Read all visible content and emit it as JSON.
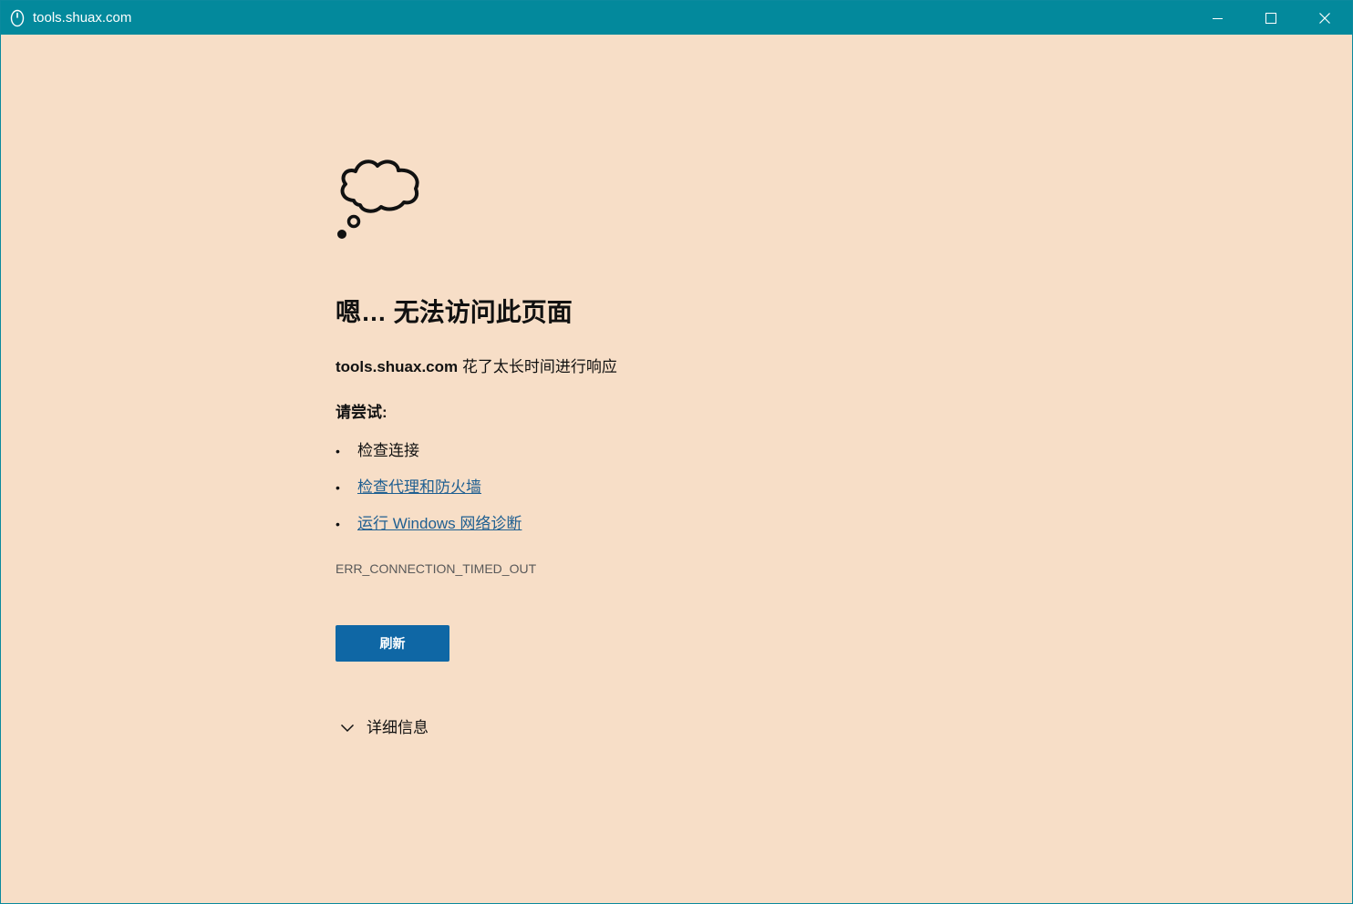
{
  "window": {
    "title": "tools.shuax.com",
    "icon": "edge-app-icon",
    "controls": {
      "minimize_icon": "minimize-icon",
      "maximize_icon": "maximize-icon",
      "close_icon": "close-icon"
    }
  },
  "colors": {
    "titlebar": "#03899c",
    "background": "#f7dec7",
    "link": "#1f5f91",
    "button": "#0f67a5"
  },
  "page": {
    "icon": "thought-cloud-icon",
    "heading": "嗯… 无法访问此页面",
    "message": {
      "host": "tools.shuax.com",
      "text": " 花了太长时间进行响应"
    },
    "try_label": "请尝试:",
    "suggestions": [
      {
        "text": "检查连接",
        "link": false
      },
      {
        "text": "检查代理和防火墙",
        "link": true
      },
      {
        "text": "运行 Windows 网络诊断",
        "link": true
      }
    ],
    "bullet": "•",
    "error_code": "ERR_CONNECTION_TIMED_OUT",
    "refresh_label": "刷新",
    "details_label": "详细信息"
  }
}
